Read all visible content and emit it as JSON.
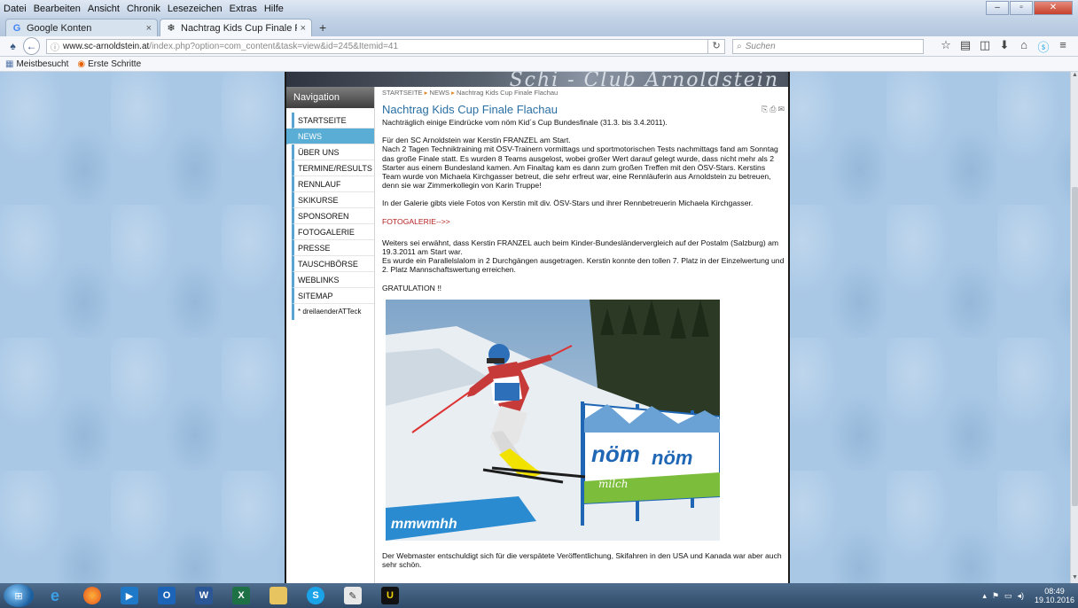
{
  "menubar": {
    "items": [
      "Datei",
      "Bearbeiten",
      "Ansicht",
      "Chronik",
      "Lesezeichen",
      "Extras",
      "Hilfe"
    ]
  },
  "tabs": [
    {
      "title": "Google Konten",
      "icon": "google-icon",
      "active": false
    },
    {
      "title": "Nachtrag Kids Cup Finale F...",
      "icon": "club-logo-icon",
      "active": true
    }
  ],
  "navbar": {
    "url_domain": "www.sc-arnoldstein.at",
    "url_path": "/index.php?option=com_content&task=view&id=245&Itemid=41",
    "search_placeholder": "Suchen"
  },
  "bookmarks": [
    {
      "label": "Meistbesucht",
      "icon": "bookmark-folder-icon"
    },
    {
      "label": "Erste Schritte",
      "icon": "firefox-icon"
    }
  ],
  "site": {
    "banner_text": "Schi - Club Arnoldstein",
    "nav_header": "Navigation",
    "nav_items": [
      "STARTSEITE",
      "NEWS",
      "ÜBER UNS",
      "TERMINE/RESULTS",
      "RENNLAUF",
      "SKIKURSE",
      "SPONSOREN",
      "FOTOGALERIE",
      "PRESSE",
      "TAUSCHBÖRSE",
      "WEBLINKS",
      "SITEMAP",
      "* dreilaenderATTeck"
    ],
    "active_nav": "NEWS",
    "breadcrumb": {
      "home": "STARTSEITE",
      "news": "NEWS",
      "current": "Nachtrag Kids Cup Finale Flachau"
    },
    "article": {
      "title": "Nachtrag Kids Cup Finale Flachau",
      "intro": "Nachträglich einige Eindrücke vom nöm Kid´s Cup Bundesfinale (31.3. bis 3.4.2011).",
      "p1_line1": "Für den SC Arnoldstein war Kerstin FRANZEL am Start.",
      "p1_body": "Nach 2 Tagen Techniktraining mit ÖSV-Trainern vormittags und sportmotorischen Tests nachmittags fand am Sonntag das große Finale statt. Es wurden 8 Teams ausgelost, wobei großer Wert darauf gelegt wurde, dass nicht mehr als 2 Starter aus einem Bundesland kamen. Am Finaltag kam es dann zum großen Treffen mit den ÖSV-Stars. Kerstins Team wurde von Michaela Kirchgasser betreut, die sehr erfreut war, eine Rennläuferin aus Arnoldstein zu betreuen, denn sie war Zimmerkollegin von Karin Truppe!",
      "p2": "In der Galerie gibts viele Fotos von Kerstin mit div. ÖSV-Stars und ihrer Rennbetreuerin Michaela Kirchgasser.",
      "gallery_link": "FOTOGALERIE-->>",
      "p3_line1": "Weiters sei erwähnt, dass Kerstin FRANZEL auch beim Kinder-Bundesländervergleich auf der Postalm (Salzburg) am 19.3.2011 am Start war.",
      "p3_line2": "Es wurde ein Parallelslalom in 2 Durchgängen ausgetragen. Kerstin konnte den tollen 7. Platz in der Einzelwertung und 2. Platz Mannschaftswertung erreichen.",
      "gratulation": "GRATULATION !!",
      "photo_banner_text": "nöm",
      "photo_banner_sub": "milch",
      "footer": "Der Webmaster entschuldigt sich für die verspätete Veröffentlichung, Skifahren in den USA und Kanada war aber auch sehr schön."
    }
  },
  "taskbar": {
    "apps": [
      "internet-explorer-icon",
      "firefox-icon",
      "media-player-icon",
      "outlook-icon",
      "word-icon",
      "excel-icon",
      "file-explorer-icon",
      "skype-icon",
      "paint-icon",
      "u-app-icon"
    ],
    "clock_time": "08:49",
    "clock_date": "19.10.2016"
  }
}
